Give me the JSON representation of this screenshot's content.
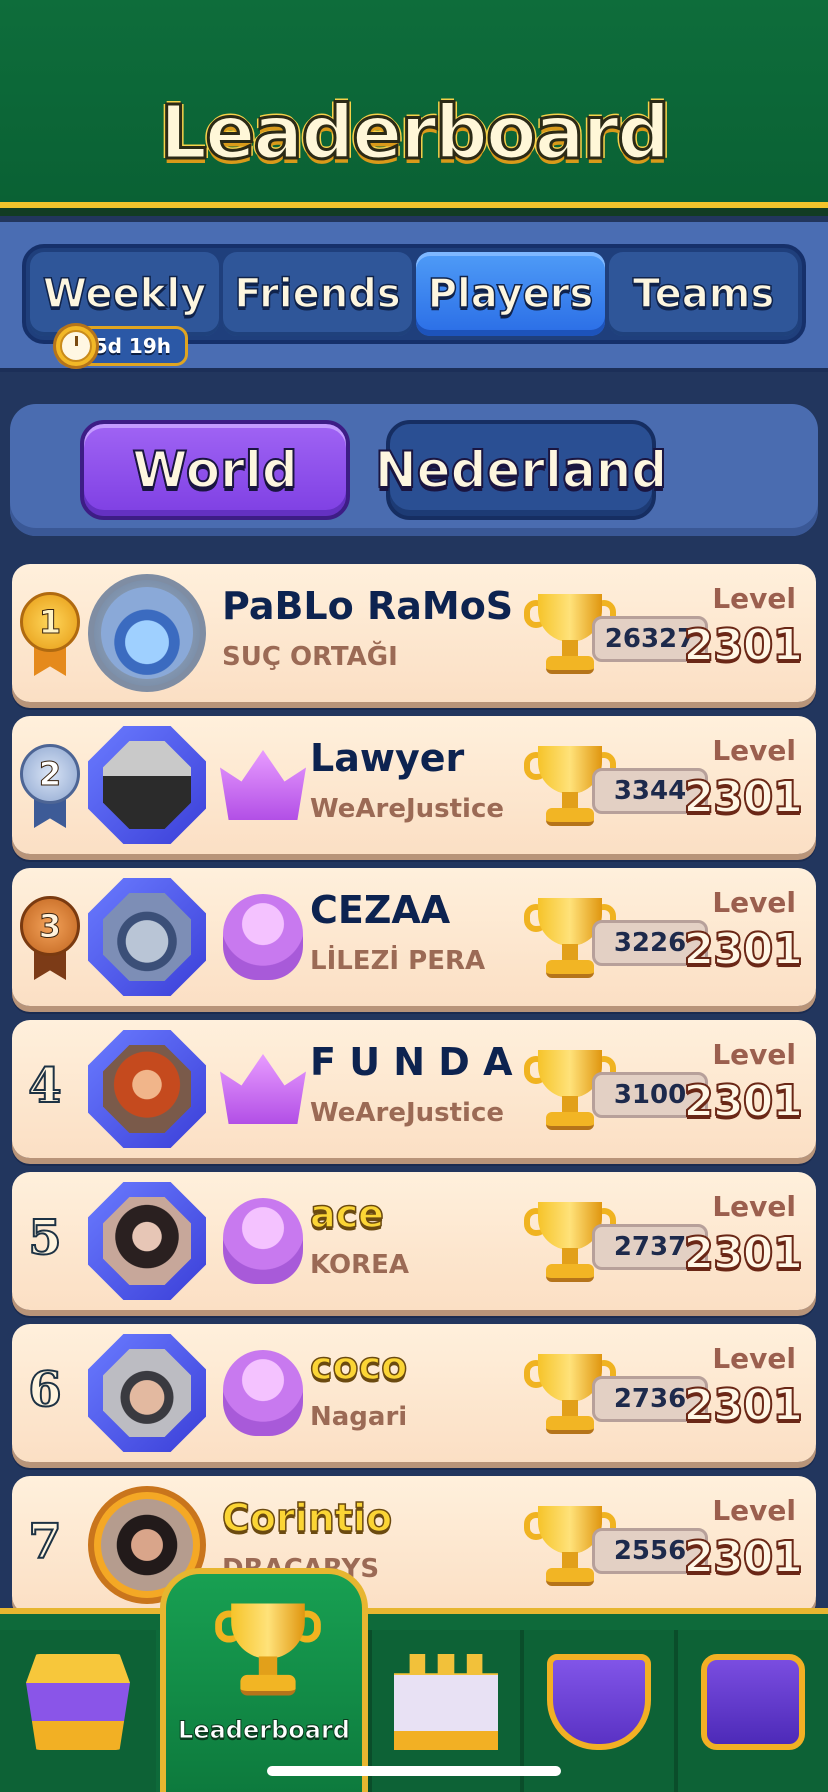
{
  "header": {
    "title": "Leaderboard"
  },
  "tabs": [
    {
      "label": "Weekly",
      "active": false
    },
    {
      "label": "Friends",
      "active": false
    },
    {
      "label": "Players",
      "active": true
    },
    {
      "label": "Teams",
      "active": false
    }
  ],
  "weekly_timer": "5d 19h",
  "region": {
    "world_label": "World",
    "country_label": "Nederland",
    "selected": "World"
  },
  "level_label": "Level",
  "players": [
    {
      "rank": "1",
      "name": "PaBLo RaMoS",
      "team": "SUÇ ORTAĞI",
      "score": "26327",
      "level": "2301",
      "medal": "gold",
      "avatar": "king-avatar"
    },
    {
      "rank": "2",
      "name": "Lawyer",
      "team": "WeAreJustice",
      "score": "3344",
      "level": "2301",
      "medal": "silver",
      "avatar": "photo-avatar"
    },
    {
      "rank": "3",
      "name": "CEZAA",
      "team": "LİLEZİ PERA",
      "score": "3226",
      "level": "2301",
      "medal": "bronze",
      "avatar": "knight-avatar"
    },
    {
      "rank": "4",
      "name": "F U N D A",
      "team": "WeAreJustice",
      "score": "3100",
      "level": "2301",
      "medal": "none",
      "avatar": "photo-avatar"
    },
    {
      "rank": "5",
      "name": "ace",
      "team": "KOREA",
      "score": "2737",
      "level": "2301",
      "medal": "none",
      "avatar": "photo-avatar"
    },
    {
      "rank": "6",
      "name": "coco",
      "team": "Nagari",
      "score": "2736",
      "level": "2301",
      "medal": "none",
      "avatar": "photo-avatar"
    },
    {
      "rank": "7",
      "name": "Corintio",
      "team": "DRACARYS",
      "score": "2556",
      "level": "2301",
      "medal": "none",
      "avatar": "photo-avatar"
    }
  ],
  "bottom_nav": {
    "active_label": "Leaderboard",
    "items": [
      "shop-icon",
      "leaderboard-trophy-icon",
      "castle-icon",
      "team-shield-icon",
      "card-collection-icon"
    ]
  },
  "colors": {
    "header_green": "#0e6d3b",
    "gold_accent": "#f2c42c",
    "active_tab_blue": "#2a6de6",
    "world_purple": "#7e3fe3",
    "row_background": "#fff0dc"
  }
}
